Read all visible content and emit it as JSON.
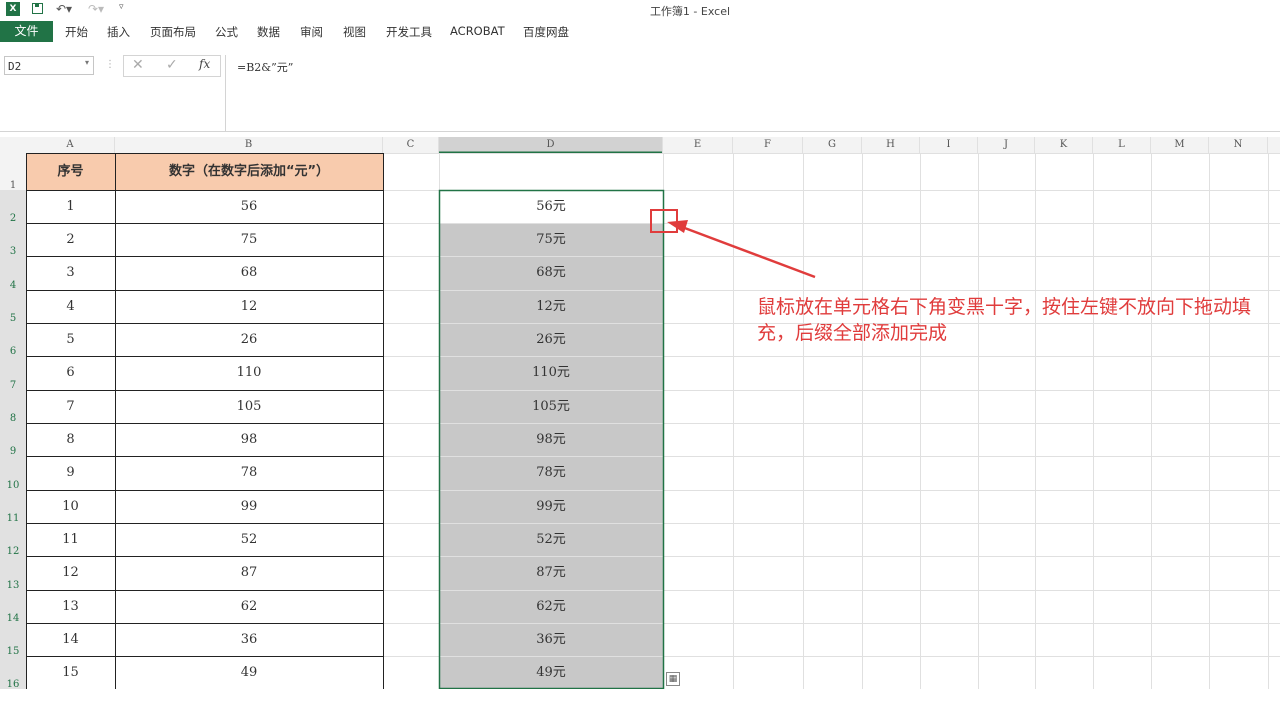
{
  "window": {
    "title": "工作簿1 - Excel"
  },
  "quick_access": {
    "app_icon": "excel-icon",
    "save_icon": "save-icon",
    "undo_icon": "undo-icon",
    "redo_icon": "redo-icon",
    "customize_icon": "customize-icon"
  },
  "ribbon": {
    "file_label": "文件",
    "tabs": [
      "开始",
      "插入",
      "页面布局",
      "公式",
      "数据",
      "审阅",
      "视图",
      "开发工具",
      "ACROBAT",
      "百度网盘"
    ]
  },
  "formula_bar": {
    "name_box": "D2",
    "cancel_icon": "cancel-icon",
    "enter_icon": "enter-icon",
    "fx_label": "fx",
    "formula": "=B2&”元”"
  },
  "sheet": {
    "columns": [
      "A",
      "B",
      "C",
      "D",
      "E",
      "F",
      "G",
      "H",
      "I",
      "J",
      "K",
      "L",
      "M",
      "N"
    ],
    "rows": [
      "1",
      "2",
      "3",
      "4",
      "5",
      "6",
      "7",
      "8",
      "9",
      "10",
      "11",
      "12",
      "13",
      "14",
      "15",
      "16"
    ],
    "header_a": "序号",
    "header_b": "数字（在数字后添加“元”）",
    "col_a": [
      "1",
      "2",
      "3",
      "4",
      "5",
      "6",
      "7",
      "8",
      "9",
      "10",
      "11",
      "12",
      "13",
      "14",
      "15"
    ],
    "col_b": [
      "56",
      "75",
      "68",
      "12",
      "26",
      "110",
      "105",
      "98",
      "78",
      "99",
      "52",
      "87",
      "62",
      "36",
      "49"
    ],
    "col_d": [
      "56元",
      "75元",
      "68元",
      "12元",
      "26元",
      "110元",
      "105元",
      "98元",
      "78元",
      "99元",
      "52元",
      "87元",
      "62元",
      "36元",
      "49元"
    ],
    "selected_cell": "D2",
    "selection_fill": "#c8c8c8",
    "header_fill": "#f8cbad"
  },
  "annotation": {
    "text_line1": "鼠标放在单元格右下角变黑十字，按住左键不放向下拖动填",
    "text_line2": "充，后缀全部添加完成",
    "color": "#e03c3c"
  }
}
